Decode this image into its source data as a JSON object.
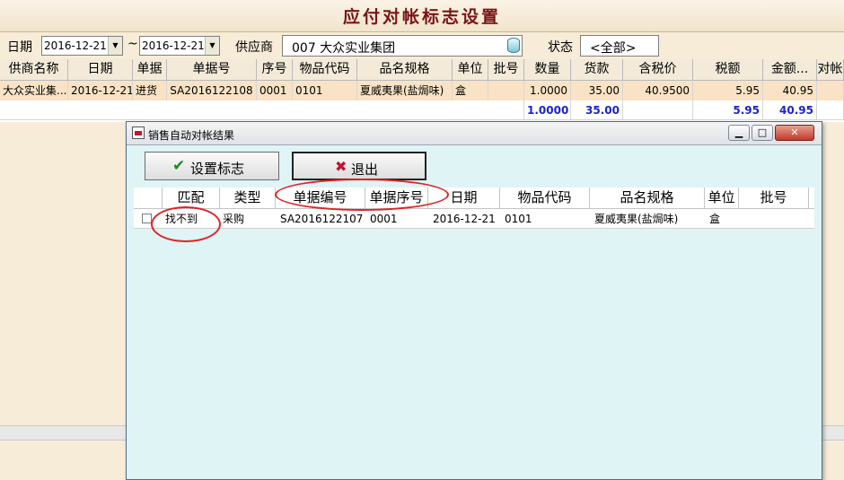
{
  "window": {
    "title": "应付对帐标志设置"
  },
  "filters": {
    "date_label": "日期",
    "date_from": "2016-12-21",
    "range_sep": "~",
    "date_to": "2016-12-21",
    "supplier_label": "供应商",
    "supplier_value": "007  大众实业集团",
    "state_label": "状态",
    "state_value": "<全部>"
  },
  "main_table": {
    "headers": [
      "供商名称",
      "日期",
      "单据",
      "单据号",
      "序号",
      "物品代码",
      "品名规格",
      "单位",
      "批号",
      "数量",
      "货款",
      "含税价",
      "税额",
      "金额...",
      "对帐"
    ],
    "rows": [
      [
        "大众实业集...",
        "2016-12-21",
        "进货",
        "SA2016122108",
        "0001",
        "0101",
        "夏威夷果(盐焗味)",
        "盒",
        "",
        "1.0000",
        "35.00",
        "40.9500",
        "5.95",
        "40.95",
        ""
      ]
    ],
    "totals": {
      "qty": "1.0000",
      "goods": "35.00",
      "tax": "5.95",
      "amount": "40.95"
    }
  },
  "dialog": {
    "title": "销售自动对帐结果",
    "set_flag_label": "设置标志",
    "exit_label": "退出",
    "headers": [
      "匹配",
      "类型",
      "单据编号",
      "单据序号",
      "日期",
      "物品代码",
      "品名规格",
      "单位",
      "批号"
    ],
    "rows": [
      [
        "找不到",
        "采购",
        "SA2016122107",
        "0001",
        "2016-12-21",
        "0101",
        "夏威夷果(盐焗味)",
        "盒",
        ""
      ]
    ]
  },
  "icons": {
    "check": "check-icon",
    "x": "x-icon",
    "database": "database-icon"
  },
  "colors": {
    "title_red": "#7a1515",
    "row_highlight": "#f9e3c4",
    "total_blue": "#1a23c9",
    "dialog_bg": "#dff4f5",
    "annotation_red": "#e02323"
  }
}
